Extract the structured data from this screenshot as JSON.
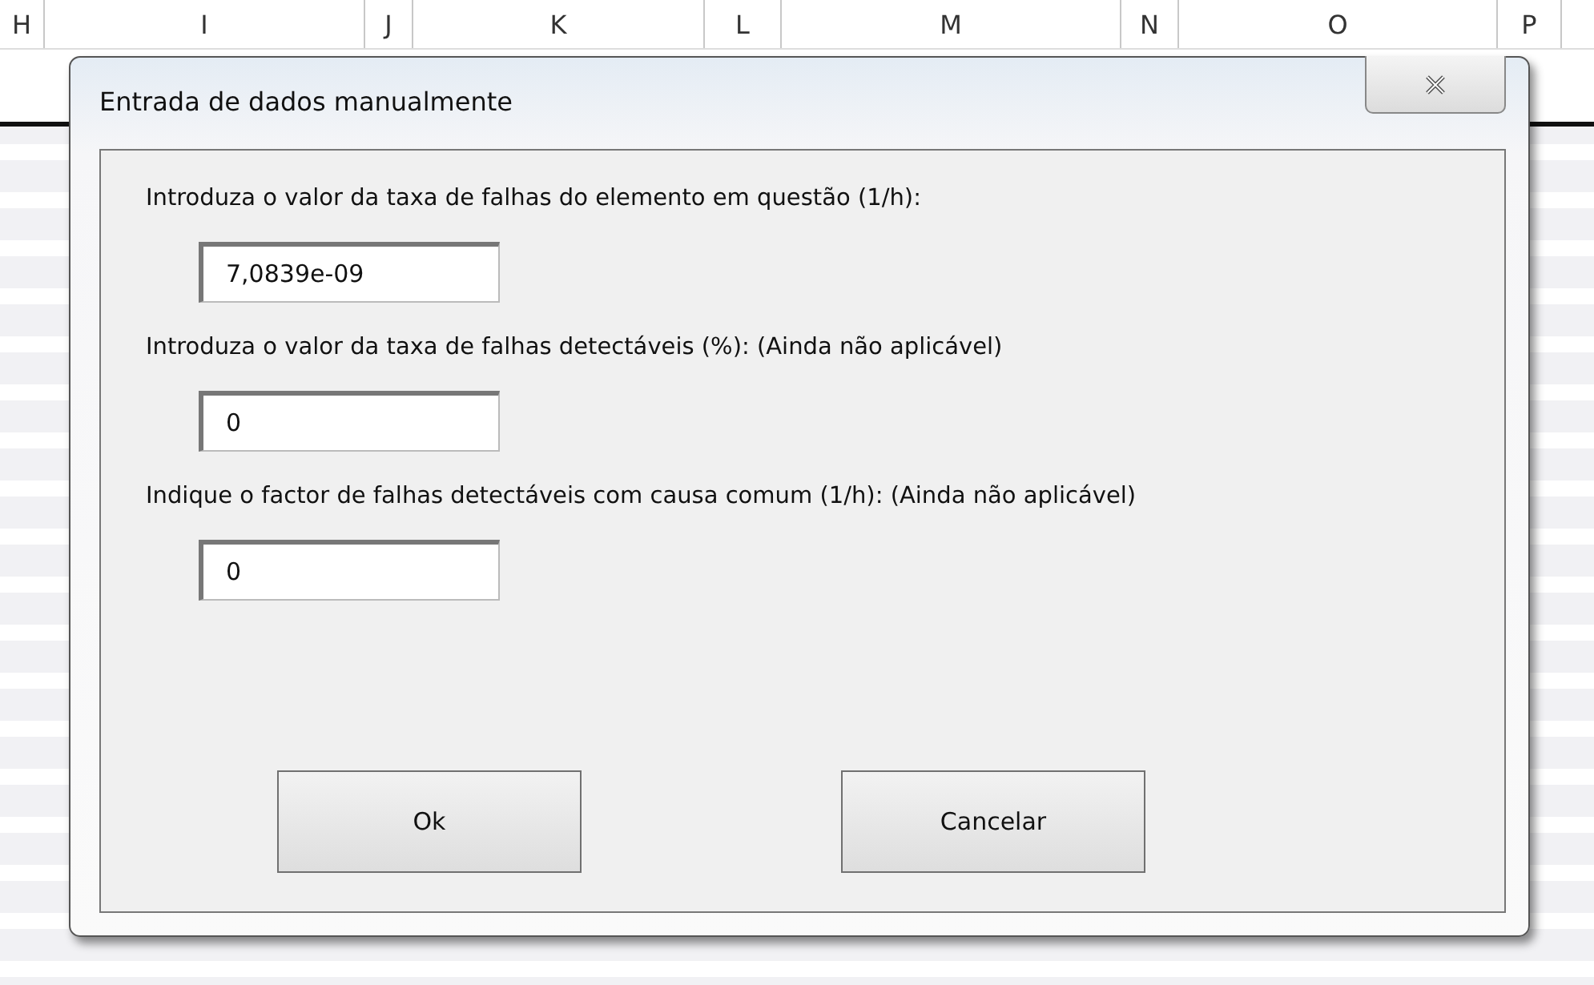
{
  "spreadsheet": {
    "columns": [
      "H",
      "I",
      "J",
      "K",
      "L",
      "M",
      "N",
      "O",
      "P"
    ]
  },
  "dialog": {
    "title": "Entrada de dados manualmente",
    "fields": [
      {
        "label": "Introduza o valor da taxa de falhas do elemento em questão (1/h):",
        "value": "7,0839e-09"
      },
      {
        "label": "Introduza o valor da taxa de falhas detectáveis (%): (Ainda não aplicável)",
        "value": "0"
      },
      {
        "label": "Indique o factor de falhas detectáveis com causa comum (1/h): (Ainda não aplicável)",
        "value": "0"
      }
    ],
    "buttons": [
      "Ok",
      "Cancelar"
    ]
  }
}
